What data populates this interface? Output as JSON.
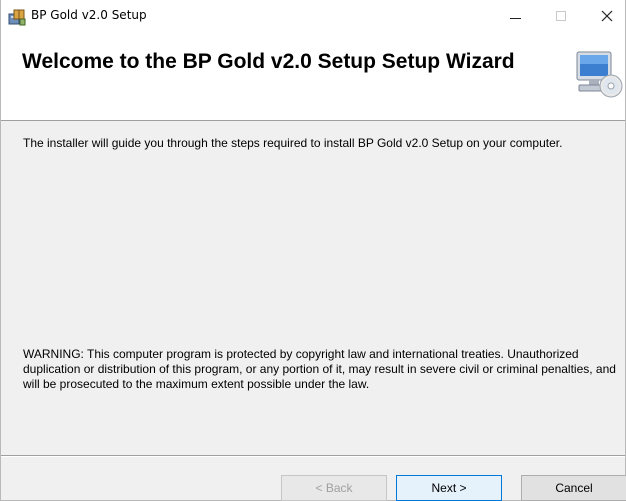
{
  "window": {
    "title": "BP Gold v2.0 Setup",
    "icons": {
      "app": "installer-box-icon",
      "minimize": "minimize-icon",
      "maximize": "maximize-icon",
      "close": "close-icon"
    }
  },
  "banner": {
    "title": "Welcome to the BP Gold v2.0 Setup Setup Wizard",
    "graphic": "computer-cd-icon"
  },
  "body": {
    "intro": "The installer will guide you through the steps required to install BP Gold v2.0 Setup on your computer.",
    "warning": "WARNING: This computer program is protected by copyright law and international treaties. Unauthorized duplication or distribution of this program, or any portion of it, may result in severe civil or criminal penalties, and will be prosecuted to the maximum extent possible under the law."
  },
  "buttons": {
    "back": "< Back",
    "next": "Next >",
    "cancel": "Cancel"
  },
  "colors": {
    "dialog_bg": "#f0f0f0",
    "banner_bg": "#ffffff",
    "default_button_border": "#0078d7"
  }
}
